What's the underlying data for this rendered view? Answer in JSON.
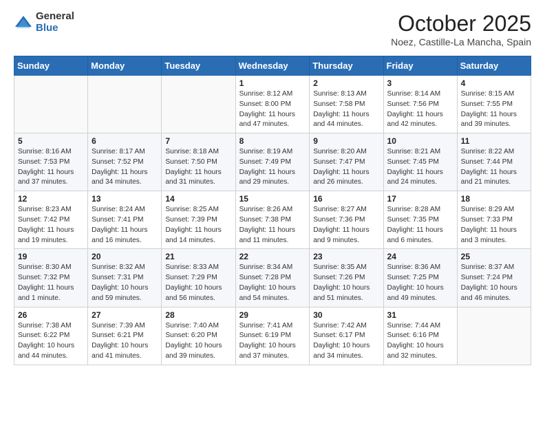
{
  "header": {
    "logo": {
      "general": "General",
      "blue": "Blue"
    },
    "month_title": "October 2025",
    "subtitle": "Noez, Castille-La Mancha, Spain"
  },
  "days_of_week": [
    "Sunday",
    "Monday",
    "Tuesday",
    "Wednesday",
    "Thursday",
    "Friday",
    "Saturday"
  ],
  "weeks": [
    [
      {
        "day": "",
        "info": ""
      },
      {
        "day": "",
        "info": ""
      },
      {
        "day": "",
        "info": ""
      },
      {
        "day": "1",
        "info": "Sunrise: 8:12 AM\nSunset: 8:00 PM\nDaylight: 11 hours and 47 minutes."
      },
      {
        "day": "2",
        "info": "Sunrise: 8:13 AM\nSunset: 7:58 PM\nDaylight: 11 hours and 44 minutes."
      },
      {
        "day": "3",
        "info": "Sunrise: 8:14 AM\nSunset: 7:56 PM\nDaylight: 11 hours and 42 minutes."
      },
      {
        "day": "4",
        "info": "Sunrise: 8:15 AM\nSunset: 7:55 PM\nDaylight: 11 hours and 39 minutes."
      }
    ],
    [
      {
        "day": "5",
        "info": "Sunrise: 8:16 AM\nSunset: 7:53 PM\nDaylight: 11 hours and 37 minutes."
      },
      {
        "day": "6",
        "info": "Sunrise: 8:17 AM\nSunset: 7:52 PM\nDaylight: 11 hours and 34 minutes."
      },
      {
        "day": "7",
        "info": "Sunrise: 8:18 AM\nSunset: 7:50 PM\nDaylight: 11 hours and 31 minutes."
      },
      {
        "day": "8",
        "info": "Sunrise: 8:19 AM\nSunset: 7:49 PM\nDaylight: 11 hours and 29 minutes."
      },
      {
        "day": "9",
        "info": "Sunrise: 8:20 AM\nSunset: 7:47 PM\nDaylight: 11 hours and 26 minutes."
      },
      {
        "day": "10",
        "info": "Sunrise: 8:21 AM\nSunset: 7:45 PM\nDaylight: 11 hours and 24 minutes."
      },
      {
        "day": "11",
        "info": "Sunrise: 8:22 AM\nSunset: 7:44 PM\nDaylight: 11 hours and 21 minutes."
      }
    ],
    [
      {
        "day": "12",
        "info": "Sunrise: 8:23 AM\nSunset: 7:42 PM\nDaylight: 11 hours and 19 minutes."
      },
      {
        "day": "13",
        "info": "Sunrise: 8:24 AM\nSunset: 7:41 PM\nDaylight: 11 hours and 16 minutes."
      },
      {
        "day": "14",
        "info": "Sunrise: 8:25 AM\nSunset: 7:39 PM\nDaylight: 11 hours and 14 minutes."
      },
      {
        "day": "15",
        "info": "Sunrise: 8:26 AM\nSunset: 7:38 PM\nDaylight: 11 hours and 11 minutes."
      },
      {
        "day": "16",
        "info": "Sunrise: 8:27 AM\nSunset: 7:36 PM\nDaylight: 11 hours and 9 minutes."
      },
      {
        "day": "17",
        "info": "Sunrise: 8:28 AM\nSunset: 7:35 PM\nDaylight: 11 hours and 6 minutes."
      },
      {
        "day": "18",
        "info": "Sunrise: 8:29 AM\nSunset: 7:33 PM\nDaylight: 11 hours and 3 minutes."
      }
    ],
    [
      {
        "day": "19",
        "info": "Sunrise: 8:30 AM\nSunset: 7:32 PM\nDaylight: 11 hours and 1 minute."
      },
      {
        "day": "20",
        "info": "Sunrise: 8:32 AM\nSunset: 7:31 PM\nDaylight: 10 hours and 59 minutes."
      },
      {
        "day": "21",
        "info": "Sunrise: 8:33 AM\nSunset: 7:29 PM\nDaylight: 10 hours and 56 minutes."
      },
      {
        "day": "22",
        "info": "Sunrise: 8:34 AM\nSunset: 7:28 PM\nDaylight: 10 hours and 54 minutes."
      },
      {
        "day": "23",
        "info": "Sunrise: 8:35 AM\nSunset: 7:26 PM\nDaylight: 10 hours and 51 minutes."
      },
      {
        "day": "24",
        "info": "Sunrise: 8:36 AM\nSunset: 7:25 PM\nDaylight: 10 hours and 49 minutes."
      },
      {
        "day": "25",
        "info": "Sunrise: 8:37 AM\nSunset: 7:24 PM\nDaylight: 10 hours and 46 minutes."
      }
    ],
    [
      {
        "day": "26",
        "info": "Sunrise: 7:38 AM\nSunset: 6:22 PM\nDaylight: 10 hours and 44 minutes."
      },
      {
        "day": "27",
        "info": "Sunrise: 7:39 AM\nSunset: 6:21 PM\nDaylight: 10 hours and 41 minutes."
      },
      {
        "day": "28",
        "info": "Sunrise: 7:40 AM\nSunset: 6:20 PM\nDaylight: 10 hours and 39 minutes."
      },
      {
        "day": "29",
        "info": "Sunrise: 7:41 AM\nSunset: 6:19 PM\nDaylight: 10 hours and 37 minutes."
      },
      {
        "day": "30",
        "info": "Sunrise: 7:42 AM\nSunset: 6:17 PM\nDaylight: 10 hours and 34 minutes."
      },
      {
        "day": "31",
        "info": "Sunrise: 7:44 AM\nSunset: 6:16 PM\nDaylight: 10 hours and 32 minutes."
      },
      {
        "day": "",
        "info": ""
      }
    ]
  ]
}
